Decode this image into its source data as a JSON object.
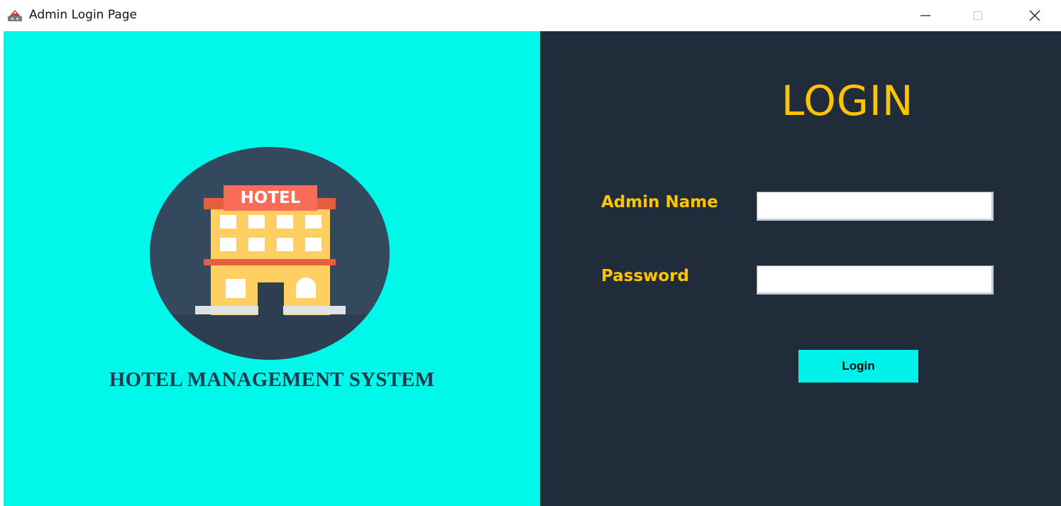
{
  "window": {
    "title": "Admin Login Page",
    "minimize_icon": "minimize-icon",
    "maximize_icon": "maximize-icon",
    "close_icon": "close-icon"
  },
  "left_panel": {
    "background": "#00f8ea",
    "logo_icon": "hotel-building-icon",
    "logo_sign": "HOTEL",
    "brand_title": "HOTEL MANAGEMENT SYSTEM"
  },
  "right_panel": {
    "background": "#212c3b",
    "heading": "LOGIN",
    "accent": "#ffc400",
    "admin_name_label": "Admin Name",
    "admin_name_value": "",
    "password_label": "Password",
    "password_value": "",
    "login_button": "Login"
  }
}
